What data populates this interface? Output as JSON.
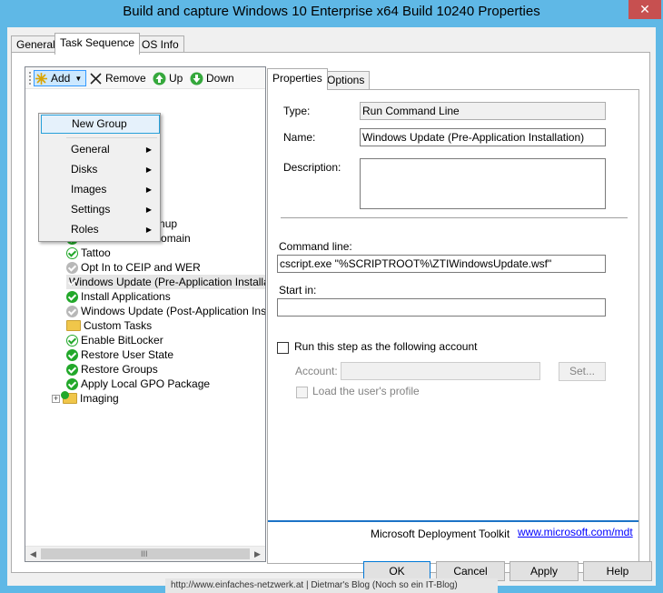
{
  "window": {
    "title": "Build and capture Windows 10 Enterprise x64 Build 10240 Properties",
    "close_glyph": "✕"
  },
  "tabs": [
    "General",
    "Task Sequence",
    "OS Info"
  ],
  "toolbar": {
    "add_label": "Add",
    "remove_label": "Remove",
    "up_label": "Up",
    "down_label": "Down"
  },
  "add_menu": {
    "items": [
      "New Group",
      "General",
      "Disks",
      "Images",
      "Settings",
      "Roles"
    ]
  },
  "tree": {
    "items": [
      "Post-Apply Cleanup",
      "Recover From Domain",
      "Tattoo",
      "Opt In to CEIP and WER",
      "Windows Update (Pre-Application Installation)",
      "Install Applications",
      "Windows Update (Post-Application Installation)",
      "Custom Tasks",
      "Enable BitLocker",
      "Restore User State",
      "Restore Groups",
      "Apply Local GPO Package",
      "Imaging"
    ],
    "expander_glyph": "+",
    "scroll_grip": "III"
  },
  "properties": {
    "tabs": [
      "Properties",
      "Options"
    ],
    "type_label": "Type:",
    "type_value": "Run Command Line",
    "name_label": "Name:",
    "name_value": "Windows Update (Pre-Application Installation)",
    "description_label": "Description:",
    "description_value": "",
    "command_line_label": "Command line:",
    "command_line_value": "cscript.exe \"%SCRIPTROOT%\\ZTIWindowsUpdate.wsf\"",
    "start_in_label": "Start in:",
    "start_in_value": "",
    "run_as_label": "Run this step as the following account",
    "account_label": "Account:",
    "account_value": "",
    "set_label": "Set...",
    "load_profile_label": "Load the user's profile",
    "toolkit_label": "Microsoft Deployment Toolkit",
    "toolkit_link": "www.microsoft.com/mdt"
  },
  "buttons": {
    "ok": "OK",
    "cancel": "Cancel",
    "apply": "Apply",
    "help": "Help"
  },
  "watermark": "http://www.einfaches-netzwerk.at | Dietmar's Blog (Noch so ein IT-Blog)",
  "colors": {
    "title_bar": "#5fb8e6",
    "close": "#c75050",
    "success": "#22a82a",
    "link": "#0000ff",
    "accent_line": "#1c73c6"
  }
}
